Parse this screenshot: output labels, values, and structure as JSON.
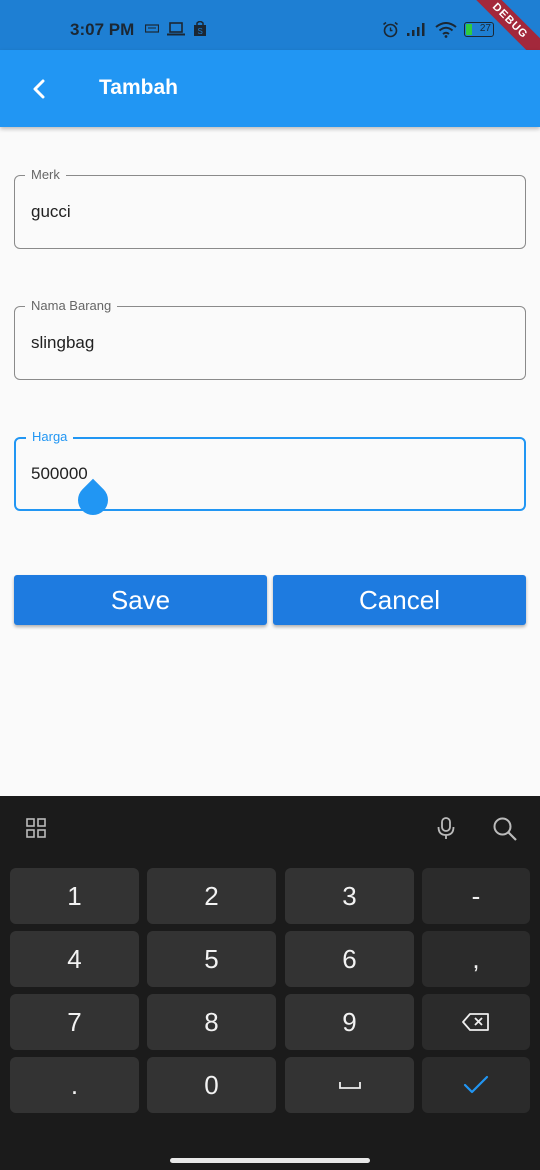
{
  "status_bar": {
    "time": "3:07 PM",
    "battery": "27",
    "debug_label": "DEBUG",
    "left_icons": [
      "keyboard-status-icon",
      "laptop-icon",
      "shopping-bag-icon"
    ],
    "right_icons": [
      "alarm-icon",
      "signal-icon",
      "wifi-icon",
      "battery-icon"
    ]
  },
  "app_bar": {
    "title": "Tambah",
    "back_icon": "chevron-left-icon"
  },
  "form": {
    "merk": {
      "label": "Merk",
      "value": "gucci"
    },
    "nama_barang": {
      "label": "Nama Barang",
      "value": "slingbag"
    },
    "harga": {
      "label": "Harga",
      "value": "500000"
    }
  },
  "actions": {
    "save_label": "Save",
    "cancel_label": "Cancel"
  },
  "keyboard": {
    "toolbar_icons": [
      "grid-icon",
      "microphone-icon",
      "search-icon"
    ],
    "keys": [
      [
        "1",
        "2",
        "3",
        "-"
      ],
      [
        "4",
        "5",
        "6",
        ","
      ],
      [
        "7",
        "8",
        "9",
        "backspace"
      ],
      [
        ".",
        "0",
        "space",
        "done"
      ]
    ]
  },
  "colors": {
    "app_bar": "#2196f3",
    "status_bar": "#1e7fd3",
    "button": "#1e7be0",
    "focus": "#2196f3",
    "keyboard_bg": "#1b1b1b",
    "key_bg": "#333333",
    "debug_banner": "#a3283b"
  }
}
